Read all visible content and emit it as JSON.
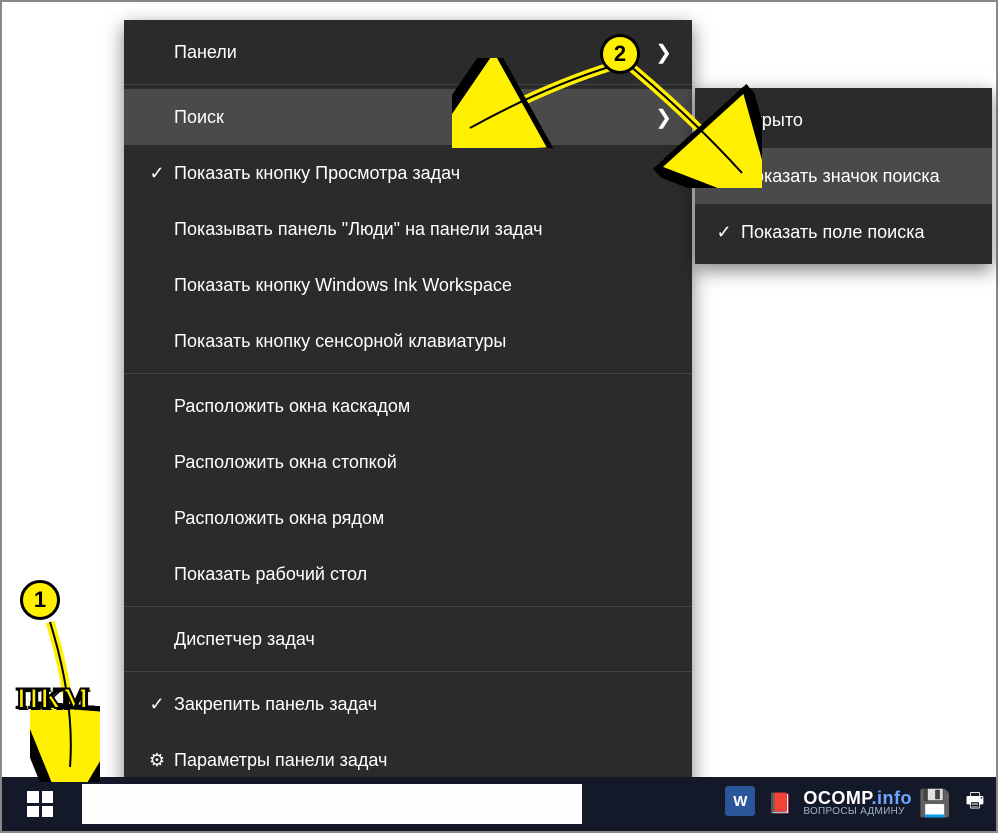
{
  "annotations": {
    "badge1": "1",
    "badge2": "2",
    "pkm_label": "ПКМ"
  },
  "main_menu": {
    "panels": "Панели",
    "search": "Поиск",
    "show_task_view": "Показать кнопку Просмотра задач",
    "show_people": "Показывать панель \"Люди\" на панели задач",
    "show_ink": "Показать кнопку Windows Ink Workspace",
    "show_touch_kb": "Показать кнопку сенсорной клавиатуры",
    "cascade": "Расположить окна каскадом",
    "stacked": "Расположить окна стопкой",
    "side_by_side": "Расположить окна рядом",
    "show_desktop": "Показать рабочий стол",
    "task_manager": "Диспетчер задач",
    "lock_taskbar": "Закрепить панель задач",
    "taskbar_settings": "Параметры панели задач"
  },
  "sub_menu": {
    "hidden": "Скрыто",
    "show_icon": "Показать значок поиска",
    "show_box": "Показать поле поиска"
  },
  "tray": {
    "brand_main": "OCOMP",
    "brand_suffix": ".info",
    "brand_sub": "ВОПРОСЫ АДМИНУ",
    "word_letter": "W"
  }
}
